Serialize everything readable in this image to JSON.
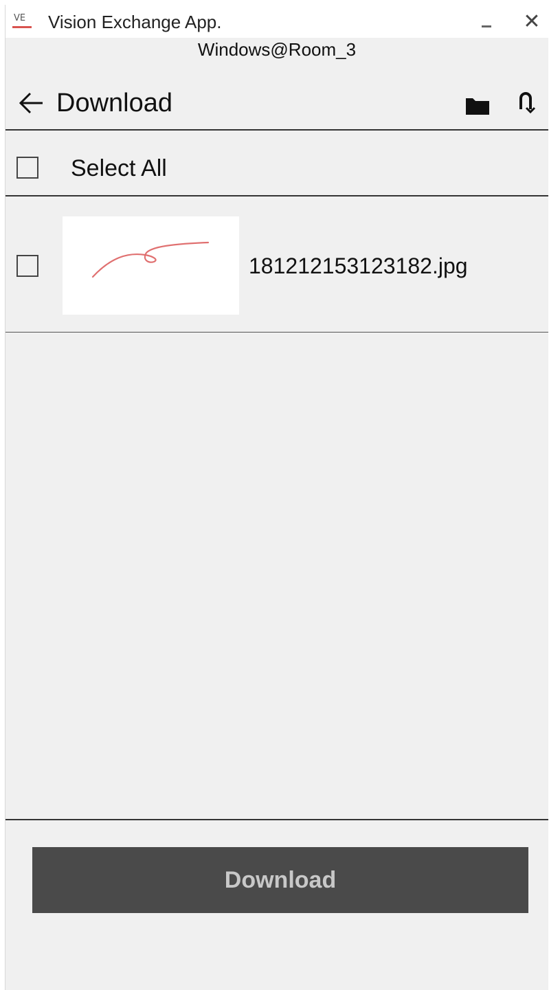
{
  "window": {
    "app_logo_text": "VE",
    "title": "Vision Exchange App.",
    "minimize_icon": "minimize-icon",
    "close_symbol": "✕"
  },
  "subtitle": "Windows@Room_3",
  "header": {
    "back_icon": "arrow-left-icon",
    "title": "Download",
    "folder_icon": "folder-icon",
    "refresh_icon": "refresh-icon"
  },
  "select_all": {
    "label": "Select All",
    "checked": false
  },
  "files": [
    {
      "name": "181212153123182.jpg",
      "checked": false
    }
  ],
  "download_button": {
    "label": "Download"
  },
  "colors": {
    "background": "#f0f0f0",
    "button_bg": "#4a4a4a",
    "button_text": "#c8c8c8",
    "thumbnail_stroke": "#e07070",
    "logo_accent": "#d9534f"
  }
}
